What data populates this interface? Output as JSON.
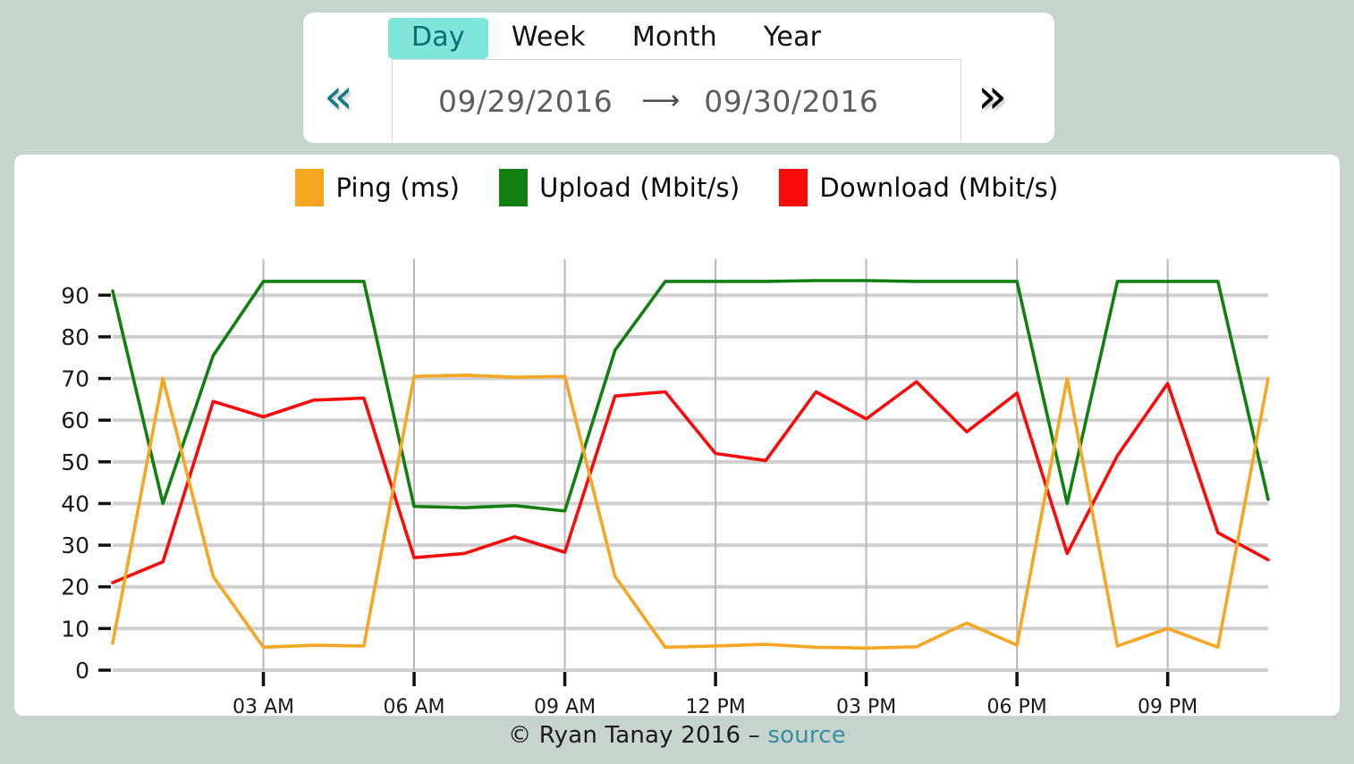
{
  "theme": {
    "page_background": "#c6d4ce",
    "card_background": "#ffffff",
    "active_tab_background": "#7fe6dc",
    "active_tab_text": "#0d6b73",
    "prev_arrow_color": "#17798a",
    "next_arrow_color": "#000000",
    "link_color": "#3a8ca3"
  },
  "controls": {
    "tabs": [
      {
        "label": "Day",
        "active": true
      },
      {
        "label": "Week",
        "active": false
      },
      {
        "label": "Month",
        "active": false
      },
      {
        "label": "Year",
        "active": false
      }
    ],
    "prev_icon": "«",
    "prev_icon_name": "double-chevron-left-icon",
    "next_icon": "»",
    "next_icon_name": "double-chevron-right-icon",
    "date_start": "09/29/2016",
    "date_arrow": "⟶",
    "date_end": "09/30/2016"
  },
  "footer": {
    "copyright": "© Ryan Tanay 2016 – ",
    "link_label": "source"
  },
  "chart_data": {
    "type": "line",
    "title": "",
    "xlabel": "",
    "ylabel": "",
    "ylim": [
      0,
      95
    ],
    "yticks": [
      0,
      10,
      20,
      30,
      40,
      50,
      60,
      70,
      80,
      90
    ],
    "grid": true,
    "legend_position": "top-center",
    "xtick_labels": [
      "03 AM",
      "06 AM",
      "09 AM",
      "12 PM",
      "03 PM",
      "06 PM",
      "09 PM"
    ],
    "xtick_hours": [
      3,
      6,
      9,
      12,
      15,
      18,
      21
    ],
    "xlim_hours": [
      0.0,
      23.0
    ],
    "x": [
      0.0,
      1.0,
      2.0,
      3.0,
      4.0,
      5.0,
      6.0,
      7.0,
      8.0,
      9.0,
      10.0,
      11.0,
      12.0,
      13.0,
      14.0,
      15.0,
      16.0,
      17.0,
      18.0,
      19.0,
      20.0,
      21.0,
      22.0,
      23.0
    ],
    "series": [
      {
        "name": "Ping (ms)",
        "unit": "ms",
        "color": "#f5a623",
        "values": [
          6.5,
          70.0,
          22.5,
          5.5,
          6.0,
          5.8,
          70.5,
          70.8,
          70.3,
          70.5,
          22.5,
          5.5,
          5.8,
          6.2,
          5.5,
          5.3,
          5.6,
          11.3,
          6.0,
          70.0,
          5.8,
          10.0,
          5.5,
          70.0
        ]
      },
      {
        "name": "Upload (Mbit/s)",
        "unit": "Mbit/s",
        "color": "#118011",
        "values": [
          91.0,
          40.0,
          75.5,
          93.3,
          93.3,
          93.3,
          39.3,
          39.0,
          39.5,
          38.2,
          76.8,
          93.3,
          93.3,
          93.3,
          93.5,
          93.5,
          93.3,
          93.3,
          93.3,
          40.0,
          93.3,
          93.3,
          93.3,
          41.0
        ]
      },
      {
        "name": "Download (Mbit/s)",
        "unit": "Mbit/s",
        "color": "#fa0a0a",
        "values": [
          21.0,
          26.0,
          64.5,
          60.8,
          64.8,
          65.3,
          27.0,
          28.0,
          32.0,
          28.3,
          65.8,
          66.8,
          52.0,
          50.3,
          66.8,
          60.3,
          69.2,
          57.2,
          66.5,
          28.0,
          51.5,
          68.8,
          33.0,
          26.5
        ]
      }
    ]
  }
}
